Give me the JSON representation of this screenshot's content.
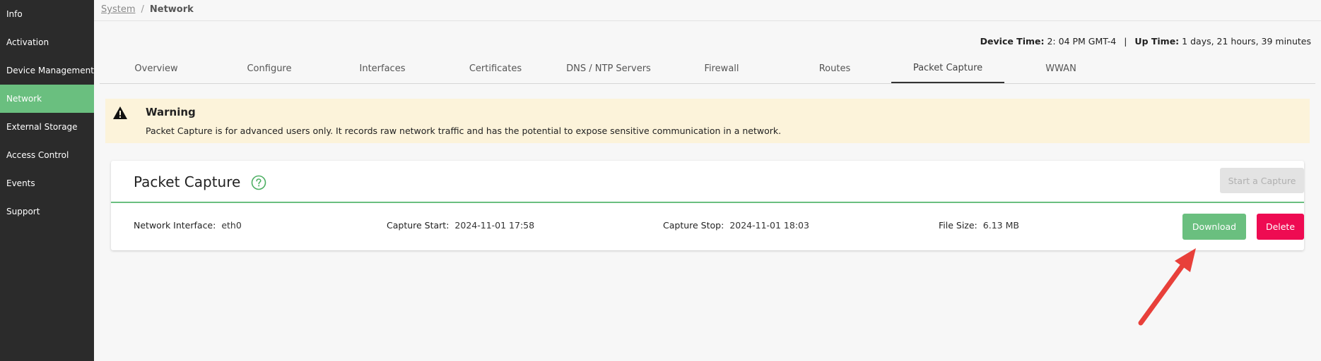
{
  "sidebar": {
    "items": [
      {
        "label": "Info"
      },
      {
        "label": "Activation"
      },
      {
        "label": "Device Management"
      },
      {
        "label": "Network",
        "active": true
      },
      {
        "label": "External Storage"
      },
      {
        "label": "Access Control"
      },
      {
        "label": "Events"
      },
      {
        "label": "Support"
      }
    ]
  },
  "breadcrumb": {
    "parent": "System",
    "separator": "/",
    "current": "Network"
  },
  "device_info": {
    "time_label": "Device Time:",
    "time_value": "2: 04 PM GMT-4",
    "divider": "|",
    "uptime_label": "Up Time:",
    "uptime_value": "1 days, 21 hours, 39 minutes"
  },
  "tabs": [
    {
      "label": "Overview"
    },
    {
      "label": "Configure"
    },
    {
      "label": "Interfaces"
    },
    {
      "label": "Certificates"
    },
    {
      "label": "DNS / NTP Servers"
    },
    {
      "label": "Firewall"
    },
    {
      "label": "Routes"
    },
    {
      "label": "Packet Capture",
      "active": true
    },
    {
      "label": "WWAN"
    }
  ],
  "warning": {
    "icon": "warning-triangle-icon",
    "title": "Warning",
    "text": "Packet Capture is for advanced users only. It records raw network traffic and has the potential to expose sensitive communication in a network."
  },
  "capture": {
    "title": "Packet Capture",
    "help_icon": "question-circle-icon",
    "start_label": "Start a Capture",
    "interface_label": "Network Interface:",
    "interface_value": "eth0",
    "start_time_label": "Capture Start:",
    "start_time_value": "2024-11-01 17:58",
    "stop_time_label": "Capture Stop:",
    "stop_time_value": "2024-11-01 18:03",
    "size_label": "File Size:",
    "size_value": "6.13 MB",
    "download_label": "Download",
    "delete_label": "Delete"
  },
  "colors": {
    "accent_green": "#6abf7f",
    "delete_red": "#ee0b52",
    "sidebar_bg": "#2b2b2b",
    "warning_bg": "#fcf3da",
    "annotation_arrow": "#e8403a"
  }
}
